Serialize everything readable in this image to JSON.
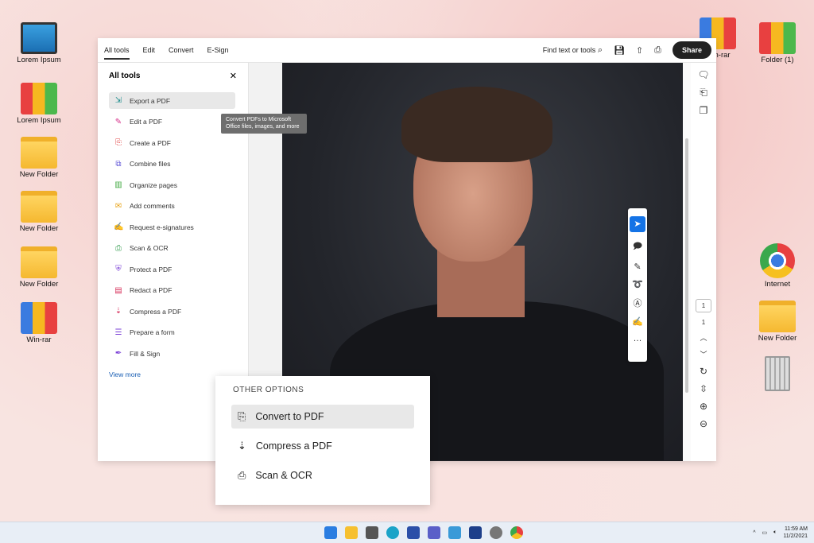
{
  "desktop": {
    "left": [
      {
        "label": "Lorem Ipsum",
        "icon": "computer-icon"
      },
      {
        "label": "Lorem Ipsum",
        "icon": "binders-icon"
      },
      {
        "label": "New Folder",
        "icon": "folder-icon"
      },
      {
        "label": "New Folder",
        "icon": "folder-icon"
      },
      {
        "label": "New Folder",
        "icon": "folder-icon"
      },
      {
        "label": "Win-rar",
        "icon": "winrar-icon"
      }
    ],
    "right": [
      {
        "label": "Win-rar",
        "icon": "winrar-icon"
      },
      {
        "label": "Folder (1)",
        "icon": "binders-icon"
      },
      {
        "label": "Internet",
        "icon": "chrome-icon"
      },
      {
        "label": "New Folder",
        "icon": "folder-icon"
      }
    ]
  },
  "app": {
    "tabs": [
      "All tools",
      "Edit",
      "Convert",
      "E-Sign"
    ],
    "search": "Find text or tools",
    "share": "Share",
    "panel": {
      "title": "All tools",
      "items": [
        {
          "label": "Export a PDF",
          "icon": "⇲",
          "color": "#1a8c8c"
        },
        {
          "label": "Edit a PDF",
          "icon": "✎",
          "color": "#d62f8a"
        },
        {
          "label": "Create a PDF",
          "icon": "⎘",
          "color": "#e03a3a"
        },
        {
          "label": "Combine files",
          "icon": "⧉",
          "color": "#5b4fd6"
        },
        {
          "label": "Organize pages",
          "icon": "▥",
          "color": "#3fa83f"
        },
        {
          "label": "Add comments",
          "icon": "✉",
          "color": "#e8a317"
        },
        {
          "label": "Request e-signatures",
          "icon": "✍",
          "color": "#7a3fd6"
        },
        {
          "label": "Scan & OCR",
          "icon": "⎙",
          "color": "#2f9a4a"
        },
        {
          "label": "Protect a PDF",
          "icon": "⛨",
          "color": "#7a3fd6"
        },
        {
          "label": "Redact a PDF",
          "icon": "▤",
          "color": "#d62f5a"
        },
        {
          "label": "Compress a PDF",
          "icon": "⇣",
          "color": "#d62f5a"
        },
        {
          "label": "Prepare a form",
          "icon": "☰",
          "color": "#7a3fd6"
        },
        {
          "label": "Fill & Sign",
          "icon": "✒",
          "color": "#7a3fd6"
        }
      ],
      "view_more": "View more"
    },
    "tooltip": "Convert PDFs to Microsoft Office files, images, and more",
    "page_number": "1",
    "page_total": "1"
  },
  "other": {
    "title": "OTHER OPTIONS",
    "items": [
      {
        "label": "Convert to PDF",
        "icon": "⎘"
      },
      {
        "label": "Compress a PDF",
        "icon": "⇣"
      },
      {
        "label": "Scan & OCR",
        "icon": "⎙"
      }
    ]
  },
  "taskbar": {
    "time": "11:59 AM",
    "date": "11/2/2021"
  }
}
